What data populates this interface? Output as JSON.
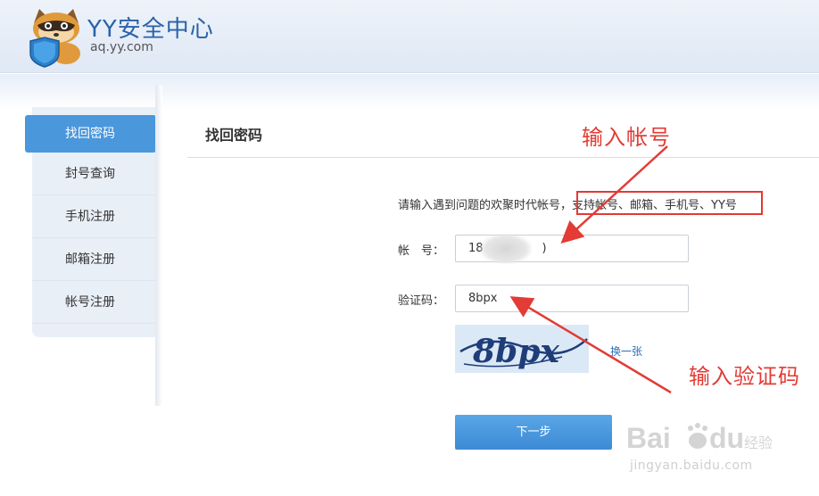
{
  "header": {
    "title": "YY安全中心",
    "domain": "aq.yy.com",
    "logo_icon": "raccoon-shield-logo",
    "logo_letter": "Y"
  },
  "sidebar": {
    "items": [
      {
        "label": "找回密码",
        "active": true
      },
      {
        "label": "封号查询",
        "active": false
      },
      {
        "label": "手机注册",
        "active": false
      },
      {
        "label": "邮箱注册",
        "active": false
      },
      {
        "label": "帐号注册",
        "active": false
      }
    ]
  },
  "main": {
    "title": "找回密码",
    "hint": "请输入遇到问题的欢聚时代帐号，支持帐号、邮箱、手机号、YY号",
    "account": {
      "label": "帐　号：",
      "value_prefix": "18",
      "value_suffix": ")"
    },
    "captcha": {
      "label": "验证码：",
      "value": "8bpx",
      "image_text": "8bpx",
      "refresh_label": "换一张"
    },
    "next_button": "下一步"
  },
  "annotations": {
    "input_account": "输入帐号",
    "input_captcha": "输入验证码",
    "color": "#e33b35"
  },
  "watermark": {
    "logo_text": "Bai",
    "logo_text2": "du",
    "logo_text3": "经验",
    "url": "jingyan.baidu.com"
  },
  "colors": {
    "accent": "#4b97dc",
    "header_title": "#2a62a8",
    "highlight_box": "#e23a33"
  }
}
